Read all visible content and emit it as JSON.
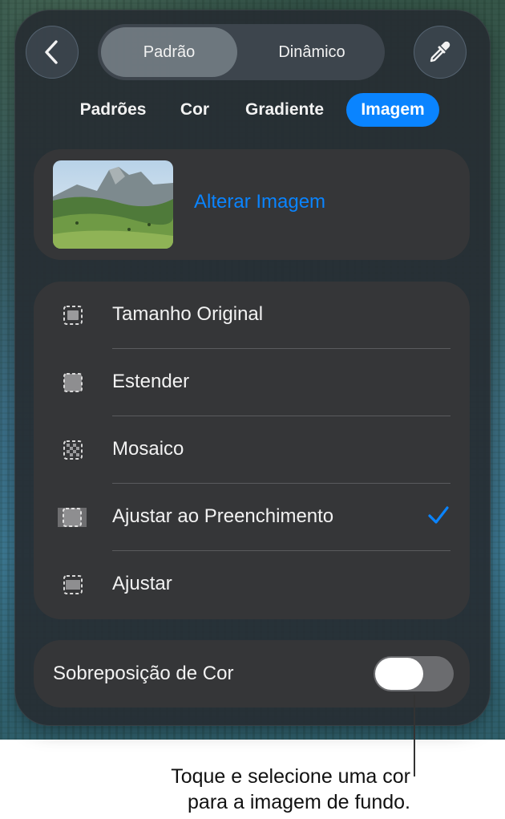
{
  "header": {
    "back_icon": "chevron-left-icon",
    "eyedropper_icon": "eyedropper-icon",
    "segments": [
      {
        "label": "Padrão",
        "active": true
      },
      {
        "label": "Dinâmico",
        "active": false
      }
    ]
  },
  "tabs": [
    {
      "label": "Padrões",
      "active": false
    },
    {
      "label": "Cor",
      "active": false
    },
    {
      "label": "Gradiente",
      "active": false
    },
    {
      "label": "Imagem",
      "active": true
    }
  ],
  "image_card": {
    "change_label": "Alterar Imagem"
  },
  "fill_options": [
    {
      "label": "Tamanho Original",
      "icon": "original-size-icon",
      "selected": false
    },
    {
      "label": "Estender",
      "icon": "stretch-icon",
      "selected": false
    },
    {
      "label": "Mosaico",
      "icon": "tile-icon",
      "selected": false
    },
    {
      "label": "Ajustar ao Preenchimento",
      "icon": "scale-to-fill-icon",
      "selected": true
    },
    {
      "label": "Ajustar",
      "icon": "scale-to-fit-icon",
      "selected": false
    }
  ],
  "overlay": {
    "label": "Sobreposição de Cor",
    "on": false
  },
  "callout": {
    "line1": "Toque e selecione uma cor",
    "line2": "para a imagem de fundo."
  },
  "colors": {
    "accent": "#0a84ff",
    "card": "#353638",
    "panel": "#262d32"
  }
}
